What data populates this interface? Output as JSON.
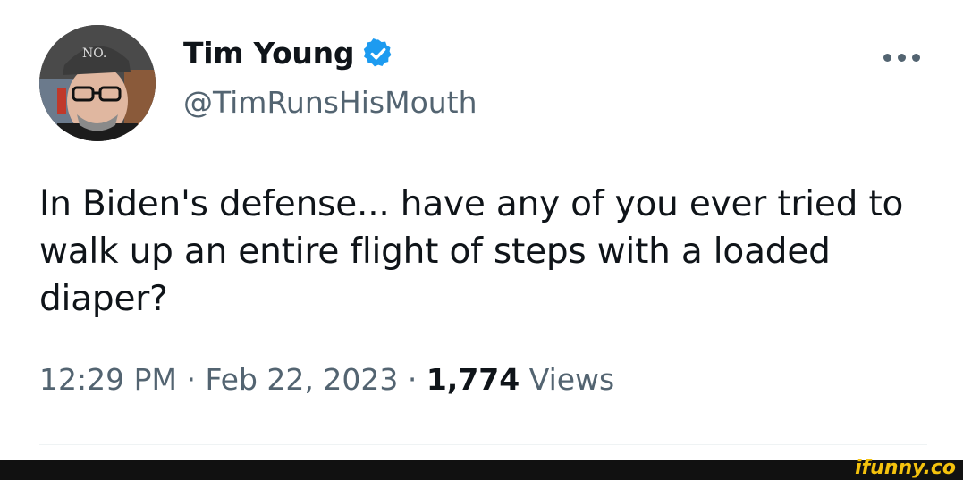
{
  "author": {
    "display_name": "Tim Young",
    "handle": "@TimRunsHisMouth",
    "verified_icon": "verified-badge-icon",
    "avatar_hat_text": "NO."
  },
  "tweet": {
    "text": "In Biden's defense... have any of you ever tried to walk up an entire flight of steps with a loaded diaper?"
  },
  "meta": {
    "time": "12:29 PM",
    "separator": "·",
    "date": "Feb 22, 2023",
    "views_count": "1,774",
    "views_label": "Views"
  },
  "more_icon": "more-options-icon",
  "watermark": "ifunny.co",
  "colors": {
    "text_primary": "#0f1419",
    "text_secondary": "#536471",
    "verified_blue": "#1d9bf0",
    "footer": "#111111",
    "watermark": "#f4c20d"
  }
}
